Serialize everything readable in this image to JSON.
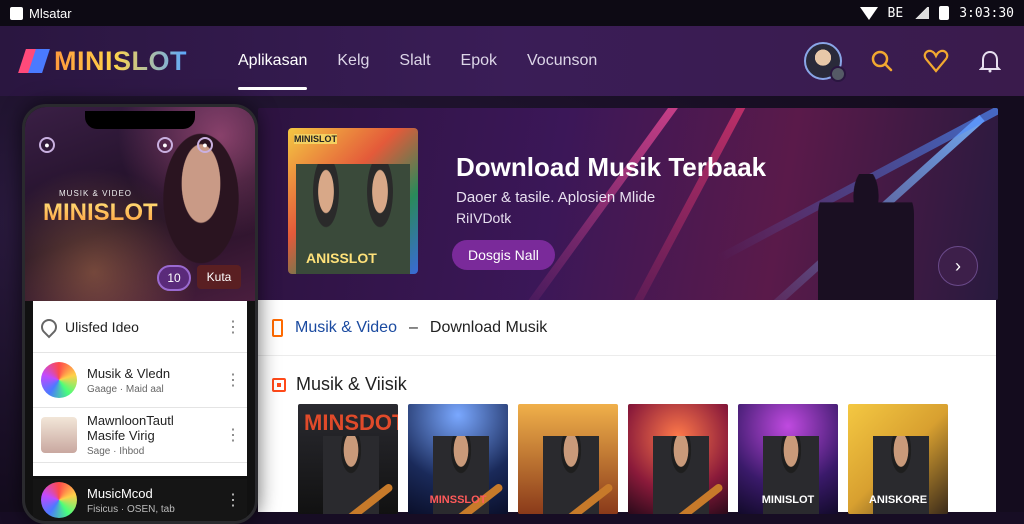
{
  "statusbar": {
    "app_label": "Mlsatar",
    "indicators": "BE",
    "time": "3:03:30"
  },
  "nav": {
    "brand": "MINISLOT",
    "links": [
      "Aplikasan",
      "Kelg",
      "Slalt",
      "Epok",
      "Vocunson"
    ],
    "active_index": 0,
    "icons": [
      "avatar",
      "search-icon",
      "heart-icon",
      "bell-icon"
    ]
  },
  "phone": {
    "hero_overtitle": "MUSIK & VIDEO",
    "hero_brand": "MINISLOT",
    "play_button": "10",
    "new_button": "Kuta",
    "list_header": "Ulisfed Ideo",
    "list": [
      {
        "title": "Musik & Vledn",
        "subtitle": "Gaage · Maid aal"
      },
      {
        "title": "MawnloonTautl",
        "title2": "Masife Virig",
        "subtitle": "Sage · Ihbod"
      }
    ],
    "bottom_item": {
      "title": "MusicMcod",
      "subtitle": "Fisicus · OSEN, tab"
    }
  },
  "banner": {
    "art_top": "MINISLOT",
    "art_bottom": "ANISSLOT",
    "title": "Download Musik Terbaak",
    "subtitle": "Daoer & tasile. Aplosien Mlide",
    "subtitle2": "RiIVDotk",
    "cta": "Dosgis Nall"
  },
  "panel": {
    "breadcrumb_1": "Musik & Video",
    "separator": "–",
    "breadcrumb_2": "Download Musik",
    "section_title": "Musik & Viisik",
    "cards": [
      {
        "label": "MINSDOT",
        "variant": "title-card"
      },
      {
        "label": "MINSSLOT",
        "variant": "stage"
      },
      {
        "label": "",
        "variant": "warm"
      },
      {
        "label": "",
        "variant": "red"
      },
      {
        "label": "MINISLOT",
        "variant": "purple"
      },
      {
        "label": "ANISKORE",
        "variant": "yellow"
      }
    ]
  },
  "colors": {
    "nav_bg": "#2a1640",
    "accent_orange": "#ff9a3c",
    "accent_purple": "#7a2a9a",
    "link_blue": "#1a4aa0"
  }
}
